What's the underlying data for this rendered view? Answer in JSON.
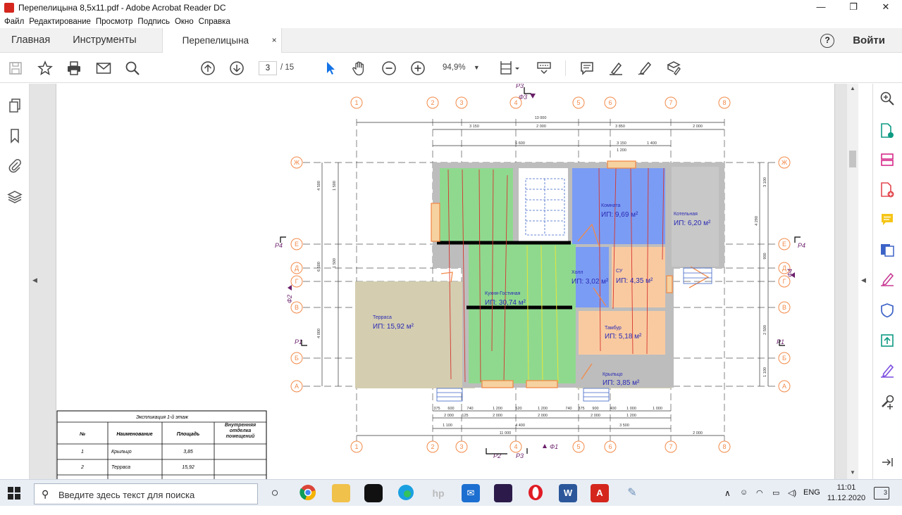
{
  "window": {
    "title": "Перепелицына 8,5x11.pdf - Adobe Acrobat Reader DC",
    "minimize": "—",
    "maximize": "❐",
    "close": "✕"
  },
  "menu": [
    "Файл",
    "Редактирование",
    "Просмотр",
    "Подпись",
    "Окно",
    "Справка"
  ],
  "tabs": {
    "home": "Главная",
    "tools": "Инструменты",
    "document": "Перепелицына 8,5...",
    "close": "×",
    "help": "?",
    "login": "Войти"
  },
  "toolbar": {
    "page_current": "3",
    "page_total": "/  15",
    "zoom": "94,9%"
  },
  "drawing": {
    "axis_numbers": [
      "1",
      "2",
      "3",
      "4",
      "5",
      "6",
      "7",
      "8"
    ],
    "axis_letters": [
      "Ж",
      "Е",
      "Д",
      "Г",
      "В",
      "Б",
      "А"
    ],
    "dim_total_top": "13 000",
    "dims_top": [
      "3 150",
      "2 000",
      "3 850",
      "2 000"
    ],
    "dim_top_2": "6 600",
    "dims_top_3": [
      "1 000",
      "1 400"
    ],
    "dim_top_4": "1 200",
    "dims_bottom_1": [
      "375",
      "600",
      "740",
      "1 200",
      "520",
      "1 200",
      "740",
      "375",
      "900",
      "400",
      "1 000",
      "1 000"
    ],
    "dims_bottom_2": [
      "2 000",
      "125",
      "2 000",
      "2 000",
      "2 000",
      "1 200"
    ],
    "dims_bottom_3": [
      "1 100",
      "4 400",
      "3 500"
    ],
    "dim_bottom_total": "11 000",
    "dim_bottom_right": "2 000",
    "dims_left": [
      "1 500",
      "1 500",
      "4 500",
      "1 500",
      "6 500",
      "4 000",
      "1 600"
    ],
    "dims_right": [
      "3 100",
      "4 290",
      "900",
      "500",
      "600",
      "1 000",
      "2 500",
      "1 300",
      "1 100",
      "1 100"
    ],
    "section_marks": [
      "Р3",
      "Ф3",
      "Р4",
      "Ф2",
      "Р1",
      "Р2",
      "Р3",
      "Ф1",
      "Р4",
      "Ф4",
      "Р1"
    ],
    "rooms": [
      {
        "name": "Комната",
        "area": "ИП: 9,69 м²"
      },
      {
        "name": "Котельная",
        "area": "ИП: 6,20 м²"
      },
      {
        "name": "Холл",
        "area": "ИП: 3,02 м²"
      },
      {
        "name": "СУ",
        "area": "ИП: 4,35 м²"
      },
      {
        "name": "Кухня-Гостиная",
        "area": "ИП: 30,74 м²"
      },
      {
        "name": "Терраса",
        "area": "ИП: 15,92 м²"
      },
      {
        "name": "Тамбур",
        "area": "ИП: 5,18 м²"
      },
      {
        "name": "Крыльцо",
        "area": "ИП: 3,85 м²"
      }
    ],
    "colors": {
      "living": "#8fd98f",
      "room": "#7b9cf4",
      "boiler": "#c8c8c8",
      "wet": "#f9caa0",
      "terrace": "#d4cdb0",
      "axis": "#f28a49",
      "text": "#2a2ab4"
    }
  },
  "table": {
    "title": "Экспликация 1-й этаж",
    "headers": [
      "№",
      "Наименование",
      "Площадь",
      "Внутренняя отделка помещений"
    ],
    "rows": [
      [
        "1",
        "Крыльцо",
        "3,85",
        ""
      ],
      [
        "2",
        "Терраса",
        "15,92",
        ""
      ]
    ]
  },
  "taskbar": {
    "search_placeholder": "Введите здесь текст для поиска",
    "lang": "ENG",
    "time": "11:01",
    "date": "11.12.2020",
    "notifications": "3"
  }
}
